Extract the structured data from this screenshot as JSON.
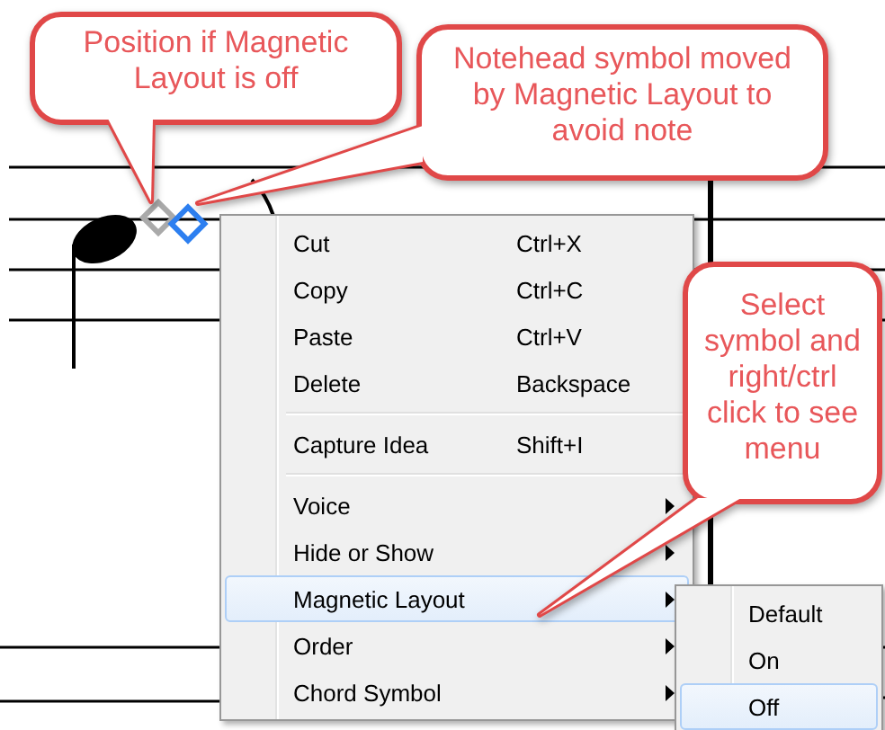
{
  "callouts": [
    {
      "text": "Position if Magnetic Layout is off"
    },
    {
      "text": "Notehead symbol moved by Magnetic Layout to avoid note"
    },
    {
      "text": "Select symbol and right/ctrl click to see menu"
    }
  ],
  "context_menu": {
    "items": [
      {
        "kind": "item",
        "label": "Cut",
        "shortcut": "Ctrl+X",
        "submenu": false,
        "selected": false
      },
      {
        "kind": "item",
        "label": "Copy",
        "shortcut": "Ctrl+C",
        "submenu": false,
        "selected": false
      },
      {
        "kind": "item",
        "label": "Paste",
        "shortcut": "Ctrl+V",
        "submenu": false,
        "selected": false
      },
      {
        "kind": "item",
        "label": "Delete",
        "shortcut": "Backspace",
        "submenu": false,
        "selected": false
      },
      {
        "kind": "separator"
      },
      {
        "kind": "item",
        "label": "Capture Idea",
        "shortcut": "Shift+I",
        "submenu": false,
        "selected": false
      },
      {
        "kind": "separator"
      },
      {
        "kind": "item",
        "label": "Voice",
        "submenu": true,
        "selected": false
      },
      {
        "kind": "item",
        "label": "Hide or Show",
        "submenu": true,
        "selected": false
      },
      {
        "kind": "item",
        "label": "Magnetic Layout",
        "submenu": true,
        "selected": true
      },
      {
        "kind": "item",
        "label": "Order",
        "submenu": true,
        "selected": false
      },
      {
        "kind": "item",
        "label": "Chord Symbol",
        "submenu": true,
        "selected": false
      }
    ]
  },
  "submenu": {
    "items": [
      {
        "label": "Default",
        "selected": false
      },
      {
        "label": "On",
        "selected": false
      },
      {
        "label": "Off",
        "selected": true
      }
    ]
  }
}
